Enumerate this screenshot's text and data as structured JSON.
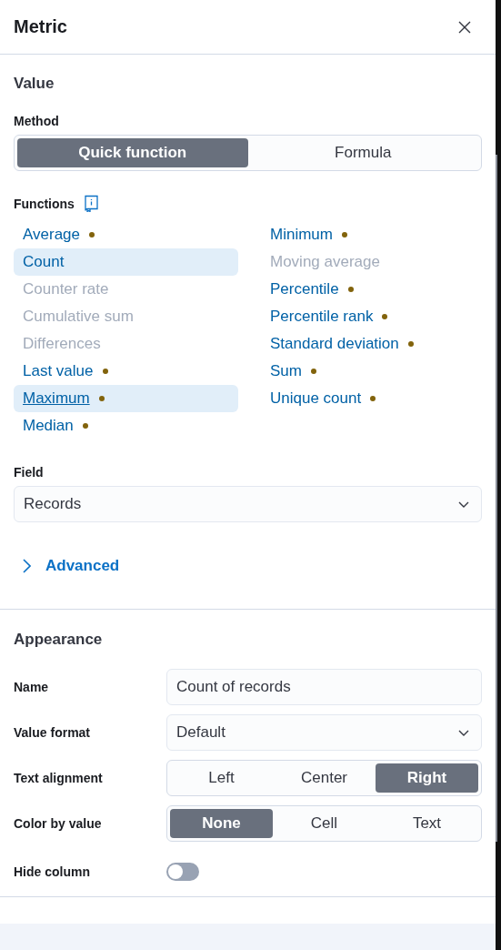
{
  "flyout": {
    "title": "Metric"
  },
  "value_section": {
    "heading": "Value",
    "method": {
      "label": "Method",
      "options": [
        {
          "label": "Quick function",
          "selected": true
        },
        {
          "label": "Formula",
          "selected": false
        }
      ]
    },
    "functions": {
      "label": "Functions",
      "items": [
        {
          "label": "Average",
          "selected": false,
          "focused": false,
          "disabled": false,
          "warning": true
        },
        {
          "label": "Count",
          "selected": true,
          "focused": false,
          "disabled": false,
          "warning": false
        },
        {
          "label": "Counter rate",
          "selected": false,
          "focused": false,
          "disabled": true,
          "warning": false
        },
        {
          "label": "Cumulative sum",
          "selected": false,
          "focused": false,
          "disabled": true,
          "warning": false
        },
        {
          "label": "Differences",
          "selected": false,
          "focused": false,
          "disabled": true,
          "warning": false
        },
        {
          "label": "Last value",
          "selected": false,
          "focused": false,
          "disabled": false,
          "warning": true
        },
        {
          "label": "Maximum",
          "selected": true,
          "focused": true,
          "disabled": false,
          "warning": true
        },
        {
          "label": "Median",
          "selected": false,
          "focused": false,
          "disabled": false,
          "warning": true
        },
        {
          "label": "Minimum",
          "selected": false,
          "focused": false,
          "disabled": false,
          "warning": true
        },
        {
          "label": "Moving average",
          "selected": false,
          "focused": false,
          "disabled": true,
          "warning": false
        },
        {
          "label": "Percentile",
          "selected": false,
          "focused": false,
          "disabled": false,
          "warning": true
        },
        {
          "label": "Percentile rank",
          "selected": false,
          "focused": false,
          "disabled": false,
          "warning": true
        },
        {
          "label": "Standard deviation",
          "selected": false,
          "focused": false,
          "disabled": false,
          "warning": true
        },
        {
          "label": "Sum",
          "selected": false,
          "focused": false,
          "disabled": false,
          "warning": true
        },
        {
          "label": "Unique count",
          "selected": false,
          "focused": false,
          "disabled": false,
          "warning": true
        }
      ]
    },
    "field": {
      "label": "Field",
      "value": "Records"
    },
    "advanced": {
      "label": "Advanced",
      "expanded": false
    }
  },
  "appearance": {
    "heading": "Appearance",
    "rows": [
      {
        "kind": "text",
        "label": "Name",
        "value": "Count of records"
      },
      {
        "kind": "select",
        "label": "Value format",
        "value": "Default"
      },
      {
        "kind": "segmented",
        "label": "Text alignment",
        "options": [
          {
            "label": "Left",
            "selected": false
          },
          {
            "label": "Center",
            "selected": false
          },
          {
            "label": "Right",
            "selected": true
          }
        ]
      },
      {
        "kind": "segmented",
        "label": "Color by value",
        "options": [
          {
            "label": "None",
            "selected": true
          },
          {
            "label": "Cell",
            "selected": false
          },
          {
            "label": "Text",
            "selected": false
          }
        ]
      },
      {
        "kind": "switch",
        "label": "Hide column",
        "on": false
      }
    ]
  }
}
